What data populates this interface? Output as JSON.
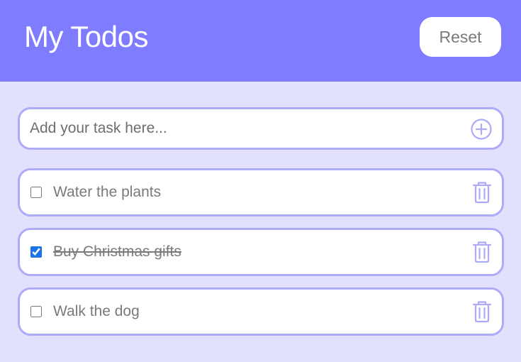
{
  "header": {
    "title": "My Todos",
    "reset_label": "Reset",
    "background_color": "#7f7cff"
  },
  "input": {
    "placeholder": "Add your task here...",
    "value": "",
    "add_icon": "plus-circle-icon"
  },
  "todos": [
    {
      "text": "Water the plants",
      "completed": false,
      "delete_icon": "trash-icon"
    },
    {
      "text": "Buy Christmas gifts",
      "completed": true,
      "delete_icon": "trash-icon"
    },
    {
      "text": "Walk the dog",
      "completed": false,
      "delete_icon": "trash-icon"
    }
  ],
  "colors": {
    "page_background": "#e2e1fd",
    "accent": "#aeabf6",
    "text": "#7a7a7a"
  }
}
